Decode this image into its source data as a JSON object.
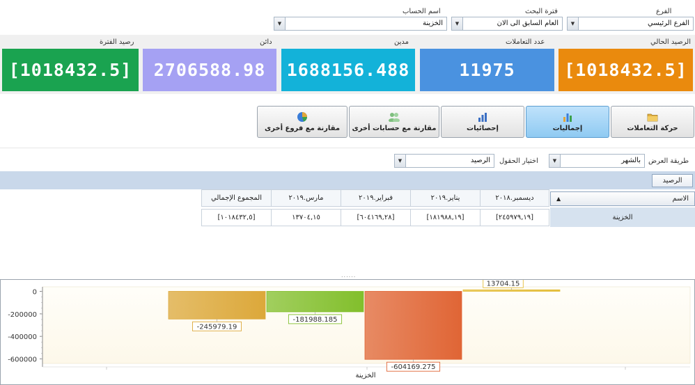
{
  "filters": {
    "branch_label": "الفرع",
    "branch_value": "الفرع الرئيسي",
    "period_label": "فترة البحث",
    "period_value": "العام السابق الى الان",
    "account_label": "اسم الحساب",
    "account_value": "الخزينة"
  },
  "tiles": [
    {
      "label": "الرصيد الحالي",
      "value": "[1018432.5]",
      "color": "#ea8a0d"
    },
    {
      "label": "عدد التعاملات",
      "value": "11975",
      "color": "#4a92e0"
    },
    {
      "label": "مدين",
      "value": "1688156.488",
      "color": "#13b2d9"
    },
    {
      "label": "دائن",
      "value": "2706588.98",
      "color": "#a5a1f3"
    },
    {
      "label": "رصيد الفترة",
      "value": "[1018432.5]",
      "color": "#1aa350"
    }
  ],
  "nav": [
    {
      "label": "حركة التعاملات",
      "icon": "folder-icon",
      "active": false
    },
    {
      "label": "إجماليات",
      "icon": "bar-chart-icon",
      "active": true
    },
    {
      "label": "إحصائيات",
      "icon": "stats-icon",
      "active": false
    },
    {
      "label": "مقارنة مع حسابات أخرى",
      "icon": "users-icon",
      "active": false
    },
    {
      "label": "مقارنة مع فروع أخرى",
      "icon": "pie-chart-icon",
      "active": false
    }
  ],
  "options": {
    "display_mode_label": "طريقة العرض",
    "display_mode_value": "بالشهر",
    "fields_label": "اختيار الحقول",
    "fields_value": "الرصيد"
  },
  "pivot": {
    "data_field": "الرصيد",
    "row_header": "الاسم",
    "columns": [
      "ديسمبر.٢٠١٨",
      "يناير.٢٠١٩",
      "فبراير.٢٠١٩",
      "مارس.٢٠١٩",
      "المجموع الإجمالي"
    ],
    "row_name": "الخزينة",
    "cells": [
      "[٢٤٥٩٧٩,١٩]",
      "[١٨١٩٨٨,١٩]",
      "[٦٠٤١٦٩,٢٨]",
      "١٣٧٠٤,١٥",
      "[١٠١٨٤٣٢,٥]"
    ]
  },
  "chart_data": {
    "type": "bar",
    "categories": [
      "الخزينة"
    ],
    "series": [
      {
        "values": [
          -245979.19
        ],
        "color": "#dca83a",
        "label": "-245979.19"
      },
      {
        "values": [
          -181988.185
        ],
        "color": "#82bf2c",
        "label": "-181988.185"
      },
      {
        "values": [
          -604169.275
        ],
        "color": "#e06535",
        "label": "-604169.275"
      },
      {
        "values": [
          13704.15
        ],
        "color": "#e4bd3a",
        "label": "13704.15"
      }
    ],
    "y_ticks": [
      "0",
      "-200000",
      "-400000",
      "-600000"
    ],
    "ylim": [
      -640000,
      40000
    ],
    "grid": false,
    "legend": "none"
  }
}
